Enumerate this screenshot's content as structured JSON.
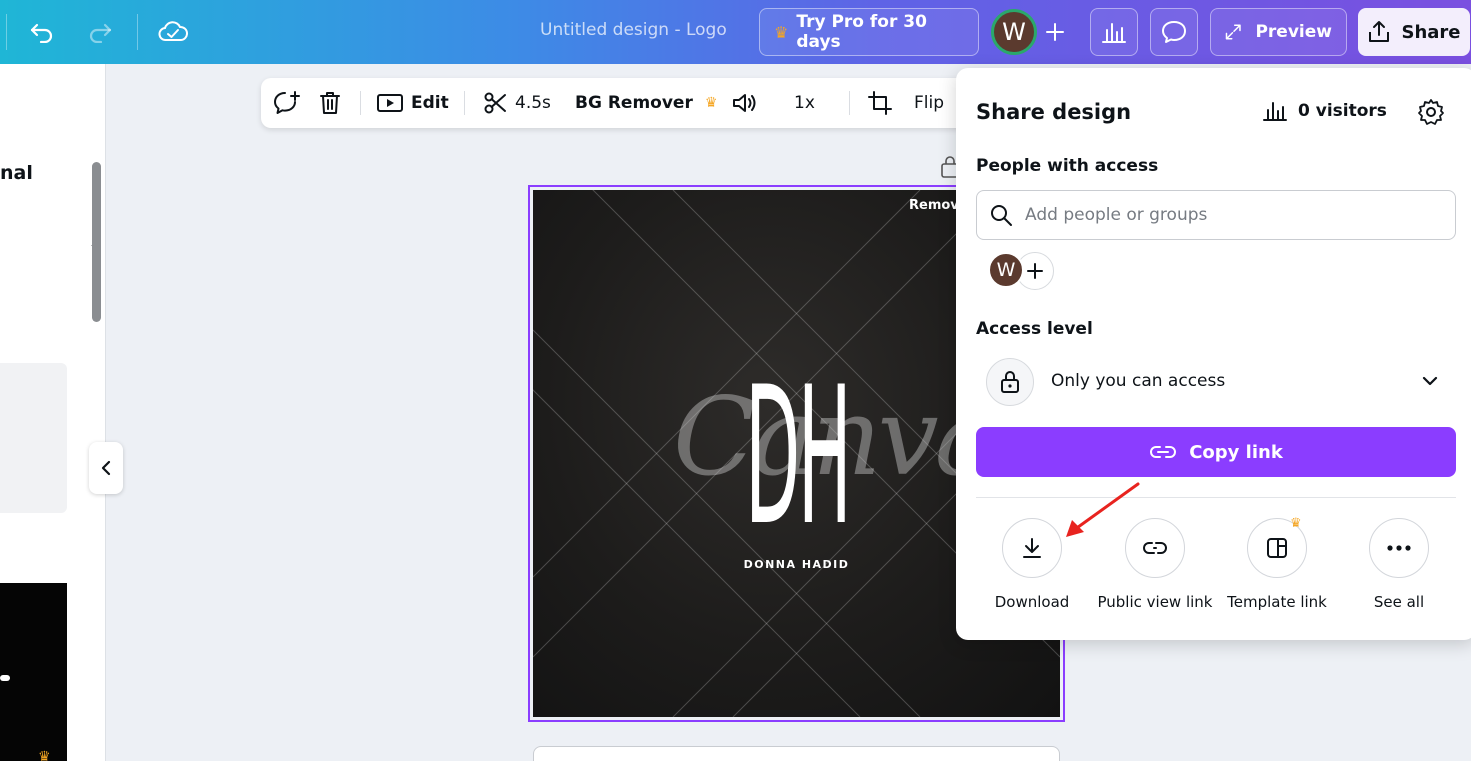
{
  "topbar": {
    "doc_title": "Untitled design - Logo",
    "try_pro_label": "Try Pro for 30 days",
    "avatar_initial": "W",
    "preview_label": "Preview",
    "share_label": "Share"
  },
  "left_panel": {
    "partial_text": "nal"
  },
  "context_toolbar": {
    "edit_label": "Edit",
    "duration_label": "4.5s",
    "bg_remover_label": "BG Remover",
    "speed_label": "1x",
    "flip_label": "Flip"
  },
  "design": {
    "watermark_text": "Canva",
    "logo_letters": "DH",
    "logo_subtitle": "DONNA HADID",
    "remove_label": "Remov"
  },
  "share_panel": {
    "title": "Share design",
    "visitors_label": "0 visitors",
    "people_access_label": "People with access",
    "search_placeholder": "Add people or groups",
    "member_initial": "W",
    "access_level_label": "Access level",
    "access_value": "Only you can access",
    "copy_link_label": "Copy link",
    "options": [
      {
        "label": "Download",
        "icon": "download-icon"
      },
      {
        "label": "Public view link",
        "icon": "link-icon"
      },
      {
        "label": "Template link",
        "icon": "template-icon",
        "pro": true
      },
      {
        "label": "See all",
        "icon": "more-icon"
      }
    ]
  },
  "colors": {
    "accent_purple": "#8b3dff",
    "pro_crown": "#f5a623",
    "annotation_arrow": "#e8231f"
  }
}
